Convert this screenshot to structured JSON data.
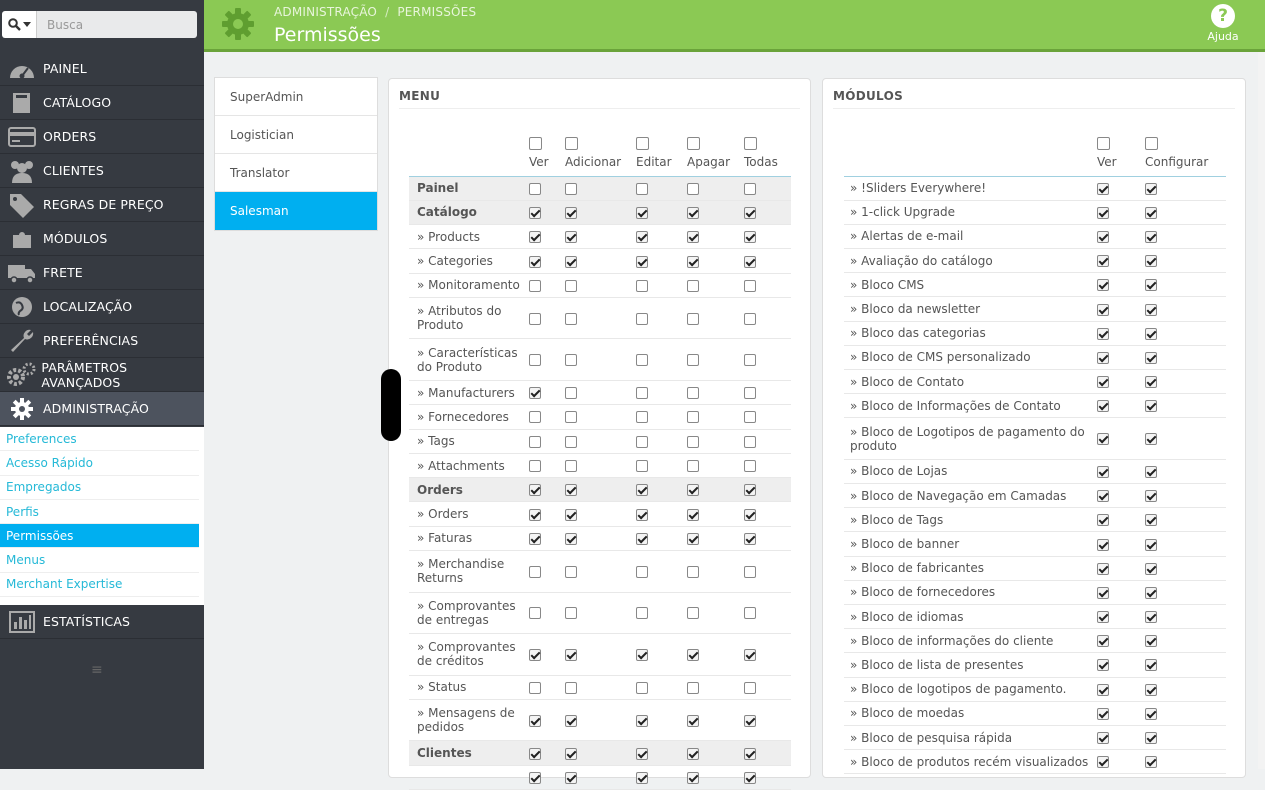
{
  "search": {
    "placeholder": "Busca"
  },
  "nav": [
    {
      "label": "PAINEL",
      "icon": "dashboard-icon"
    },
    {
      "label": "CATÁLOGO",
      "icon": "book-icon"
    },
    {
      "label": "ORDERS",
      "icon": "credit-card-icon"
    },
    {
      "label": "CLIENTES",
      "icon": "users-icon"
    },
    {
      "label": "REGRAS DE PREÇO",
      "icon": "tag-icon"
    },
    {
      "label": "MÓDULOS",
      "icon": "puzzle-icon"
    },
    {
      "label": "FRETE",
      "icon": "truck-icon"
    },
    {
      "label": "LOCALIZAÇÃO",
      "icon": "globe-icon"
    },
    {
      "label": "PREFERÊNCIAS",
      "icon": "wrench-icon"
    },
    {
      "label": "PARÂMETROS AVANÇADOS",
      "icon": "cogs-icon"
    },
    {
      "label": "ADMINISTRAÇÃO",
      "icon": "gear-icon"
    }
  ],
  "subnav": [
    {
      "label": "Preferences"
    },
    {
      "label": "Acesso Rápido"
    },
    {
      "label": "Empregados"
    },
    {
      "label": "Perfis"
    },
    {
      "label": "Permissões",
      "active": true
    },
    {
      "label": "Menus"
    },
    {
      "label": "Merchant Expertise"
    }
  ],
  "nav_stats": {
    "label": "ESTATÍSTICAS",
    "icon": "bar-chart-icon"
  },
  "header": {
    "breadcrumb": [
      "ADMINISTRAÇÃO",
      "PERMISSÕES"
    ],
    "separator": "/",
    "title": "Permissões",
    "help_label": "Ajuda",
    "help_glyph": "?"
  },
  "profiles": [
    {
      "label": "SuperAdmin"
    },
    {
      "label": "Logistician"
    },
    {
      "label": "Translator"
    },
    {
      "label": "Salesman",
      "active": true
    }
  ],
  "menu_panel": {
    "title": "MENU",
    "columns": [
      "Ver",
      "Adicionar",
      "Editar",
      "Apagar",
      "Todas"
    ],
    "rows": [
      {
        "label": "Painel",
        "head": true,
        "checks": [
          0,
          0,
          0,
          0,
          0
        ],
        "tall": false
      },
      {
        "label": "Catálogo",
        "head": true,
        "checks": [
          1,
          1,
          1,
          1,
          1
        ],
        "tall": false
      },
      {
        "label": "» Products",
        "checks": [
          1,
          1,
          1,
          1,
          1
        ],
        "tall": false
      },
      {
        "label": "» Categories",
        "checks": [
          1,
          1,
          1,
          1,
          1
        ],
        "tall": false
      },
      {
        "label": "» Monitoramento",
        "checks": [
          0,
          0,
          0,
          0,
          0
        ],
        "tall": false
      },
      {
        "label": "» Atributos do Produto",
        "checks": [
          0,
          0,
          0,
          0,
          0
        ],
        "tall": true
      },
      {
        "label": "» Características do Produto",
        "checks": [
          0,
          0,
          0,
          0,
          0
        ],
        "tall": true
      },
      {
        "label": "» Manufacturers",
        "checks": [
          1,
          0,
          0,
          0,
          0
        ],
        "tall": false
      },
      {
        "label": "» Fornecedores",
        "checks": [
          0,
          0,
          0,
          0,
          0
        ],
        "tall": false
      },
      {
        "label": "» Tags",
        "checks": [
          0,
          0,
          0,
          0,
          0
        ],
        "tall": false
      },
      {
        "label": "» Attachments",
        "checks": [
          0,
          0,
          0,
          0,
          0
        ],
        "tall": false
      },
      {
        "label": "Orders",
        "head": true,
        "checks": [
          1,
          1,
          1,
          1,
          1
        ],
        "tall": false
      },
      {
        "label": "» Orders",
        "checks": [
          1,
          1,
          1,
          1,
          1
        ],
        "tall": false
      },
      {
        "label": "» Faturas",
        "checks": [
          1,
          1,
          1,
          1,
          1
        ],
        "tall": false
      },
      {
        "label": "» Merchandise Returns",
        "checks": [
          0,
          0,
          0,
          0,
          0
        ],
        "tall": true
      },
      {
        "label": "» Comprovantes de entregas",
        "checks": [
          0,
          0,
          0,
          0,
          0
        ],
        "tall": true
      },
      {
        "label": "» Comprovantes de créditos",
        "checks": [
          1,
          1,
          1,
          1,
          1
        ],
        "tall": true
      },
      {
        "label": "» Status",
        "checks": [
          0,
          0,
          0,
          0,
          0
        ],
        "tall": false
      },
      {
        "label": "» Mensagens de pedidos",
        "checks": [
          1,
          1,
          1,
          1,
          1
        ],
        "tall": true
      },
      {
        "label": "Clientes",
        "head": true,
        "checks": [
          1,
          1,
          1,
          1,
          1
        ],
        "tall": false
      },
      {
        "label": "",
        "checks": [
          1,
          1,
          1,
          1,
          1
        ],
        "tall": false
      }
    ]
  },
  "modules_panel": {
    "title": "MÓDULOS",
    "columns": [
      "Ver",
      "Configurar"
    ],
    "rows": [
      {
        "label": "» !Sliders Everywhere!",
        "tall": false
      },
      {
        "label": "» 1-click Upgrade",
        "tall": false
      },
      {
        "label": "» Alertas de e-mail",
        "tall": false
      },
      {
        "label": "» Avaliação do catálogo",
        "tall": false
      },
      {
        "label": "» Bloco CMS",
        "tall": false
      },
      {
        "label": "» Bloco da newsletter",
        "tall": false
      },
      {
        "label": "» Bloco das categorias",
        "tall": false
      },
      {
        "label": "» Bloco de CMS personalizado",
        "tall": false
      },
      {
        "label": "» Bloco de Contato",
        "tall": false
      },
      {
        "label": "» Bloco de Informações de Contato",
        "tall": false
      },
      {
        "label": "» Bloco de Logotipos de pagamento do produto",
        "tall": true
      },
      {
        "label": "» Bloco de Lojas",
        "tall": false
      },
      {
        "label": "» Bloco de Navegação em Camadas",
        "tall": false
      },
      {
        "label": "» Bloco de Tags",
        "tall": false
      },
      {
        "label": "» Bloco de banner",
        "tall": false
      },
      {
        "label": "» Bloco de fabricantes",
        "tall": false
      },
      {
        "label": "» Bloco de fornecedores",
        "tall": false
      },
      {
        "label": "» Bloco de idiomas",
        "tall": false
      },
      {
        "label": "» Bloco de informações do cliente",
        "tall": false
      },
      {
        "label": "» Bloco de lista de presentes",
        "tall": false
      },
      {
        "label": "» Bloco de logotipos de pagamento.",
        "tall": false
      },
      {
        "label": "» Bloco de moedas",
        "tall": false
      },
      {
        "label": "» Bloco de pesquisa rápida",
        "tall": false
      },
      {
        "label": "» Bloco de produtos recém visualizados",
        "tall": false
      }
    ]
  }
}
